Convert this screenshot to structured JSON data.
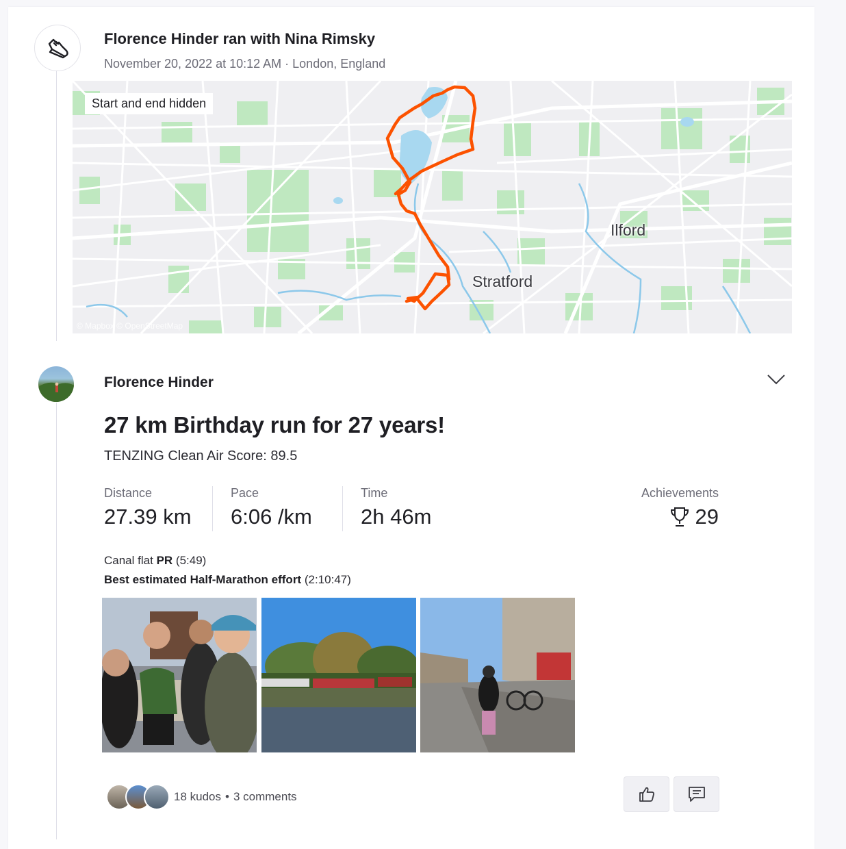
{
  "group": {
    "title": "Florence Hinder ran with Nina Rimsky",
    "meta": "November 20, 2022 at 10:12 AM · London, England",
    "icon": "running-shoe-icon"
  },
  "map": {
    "badge": "Start and end hidden",
    "labels": [
      "Stratford",
      "Ilford"
    ],
    "attribution": "© Mapbox © OpenStreetMap",
    "route_color": "#fc5200",
    "water_color": "#a8d8f0",
    "park_color": "#b8e8b8"
  },
  "activity": {
    "athlete": "Florence Hinder",
    "title": "27 km Birthday run for 27 years!",
    "description": "TENZING Clean Air Score: 89.5",
    "stats": [
      {
        "label": "Distance",
        "value": "27.39 km"
      },
      {
        "label": "Pace",
        "value": "6:06 /km"
      },
      {
        "label": "Time",
        "value": "2h 46m"
      }
    ],
    "achievements": {
      "label": "Achievements",
      "value": "29"
    },
    "segments": [
      {
        "name": "Canal flat",
        "tag": "PR",
        "time": "(5:49)"
      },
      {
        "name": "Best estimated Half-Marathon effort",
        "tag": "",
        "time": "(2:10:47)"
      }
    ]
  },
  "social": {
    "kudos": "18 kudos",
    "separator": "•",
    "comments": "3 comments",
    "like_icon": "thumbs-up-icon",
    "comment_icon": "comment-icon"
  }
}
